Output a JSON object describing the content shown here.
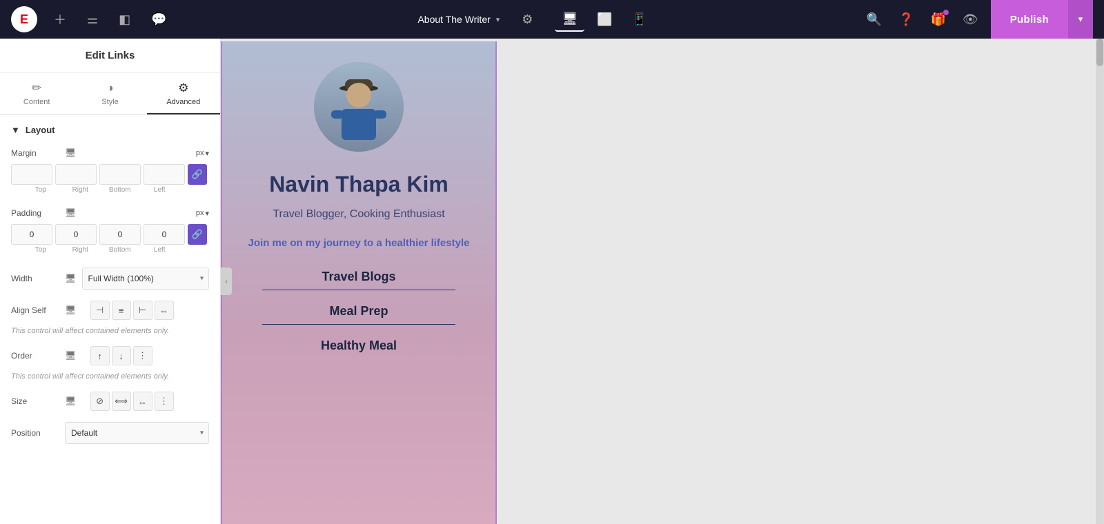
{
  "topnav": {
    "logo_text": "E",
    "page_name": "About The Writer",
    "chevron": "▾",
    "publish_label": "Publish",
    "publish_chevron": "▾"
  },
  "left_panel": {
    "title": "Edit Links",
    "tabs": [
      {
        "id": "content",
        "label": "Content",
        "icon": "✏"
      },
      {
        "id": "style",
        "label": "Style",
        "icon": "◑"
      },
      {
        "id": "advanced",
        "label": "Advanced",
        "icon": "⚙"
      }
    ],
    "active_tab": "advanced",
    "layout_section": {
      "label": "Layout",
      "margin": {
        "label": "Margin",
        "unit": "px",
        "top": "",
        "right": "",
        "bottom": "",
        "left": ""
      },
      "padding": {
        "label": "Padding",
        "unit": "px",
        "top": "0",
        "right": "0",
        "bottom": "0",
        "left": "0"
      },
      "width": {
        "label": "Width",
        "value": "Full Width (100%)"
      },
      "align_self": {
        "label": "Align Self"
      },
      "align_note": "This control will affect contained elements only.",
      "order": {
        "label": "Order"
      },
      "order_note": "This control will affect contained elements only.",
      "size": {
        "label": "Size"
      },
      "position": {
        "label": "Position",
        "value": "Default"
      }
    }
  },
  "canvas": {
    "writer_name": "Navin Thapa Kim",
    "writer_subtitle": "Travel Blogger, Cooking Enthusiast",
    "writer_tagline": "Join me on my journey to a healthier lifestyle",
    "blog_links": [
      "Travel Blogs",
      "Meal Prep",
      "Healthy Meal"
    ]
  }
}
